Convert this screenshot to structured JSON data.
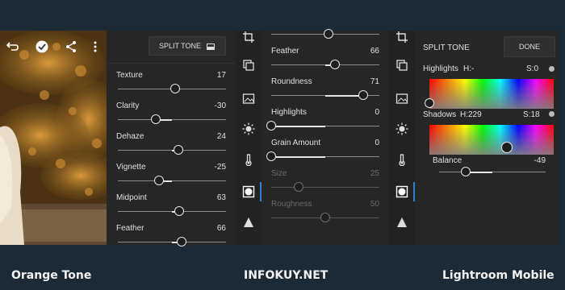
{
  "panel1": {
    "header_button": "SPLIT TONE",
    "sliders": [
      {
        "label": "Texture",
        "value": "17",
        "pos": 0.53
      },
      {
        "label": "Clarity",
        "value": "-30",
        "pos": 0.35
      },
      {
        "label": "Dehaze",
        "value": "24",
        "pos": 0.56
      },
      {
        "label": "Vignette",
        "value": "-25",
        "pos": 0.38
      },
      {
        "label": "Midpoint",
        "value": "63",
        "pos": 0.57
      },
      {
        "label": "Feather",
        "value": "66",
        "pos": 0.59
      }
    ]
  },
  "panel2": {
    "sliders": [
      {
        "label": "",
        "value": "",
        "pos": 0.53,
        "enabled": true
      },
      {
        "label": "Feather",
        "value": "66",
        "pos": 0.59,
        "enabled": true
      },
      {
        "label": "Roundness",
        "value": "71",
        "pos": 0.85,
        "enabled": true
      },
      {
        "label": "Highlights",
        "value": "0",
        "pos": 0.0,
        "enabled": true
      },
      {
        "label": "Grain Amount",
        "value": "0",
        "pos": 0.0,
        "enabled": true
      },
      {
        "label": "Size",
        "value": "25",
        "pos": 0.25,
        "enabled": false
      },
      {
        "label": "Roughness",
        "value": "50",
        "pos": 0.5,
        "enabled": false
      }
    ]
  },
  "panel3": {
    "title": "SPLIT TONE",
    "done": "DONE",
    "highlights_label": "Highlights",
    "highlights_h": "H:-",
    "highlights_s": "S:0",
    "shadows_label": "Shadows",
    "shadows_h": "H:229",
    "shadows_s": "S:18",
    "balance_label": "Balance",
    "balance_value": "-49",
    "balance_pos": 0.25
  },
  "captions": {
    "left": "Orange Tone",
    "center": "INFOKUY.NET",
    "right": "Lightroom Mobile"
  },
  "icons": [
    "undo-icon",
    "check-icon",
    "share-icon",
    "more-icon",
    "crop-icon",
    "presets-icon",
    "photo-icon",
    "light-icon",
    "color-icon",
    "effects-icon",
    "detail-icon"
  ],
  "colors": {
    "accent": "#2d7fd3",
    "panel": "#262626",
    "background": "#1c2a36"
  }
}
